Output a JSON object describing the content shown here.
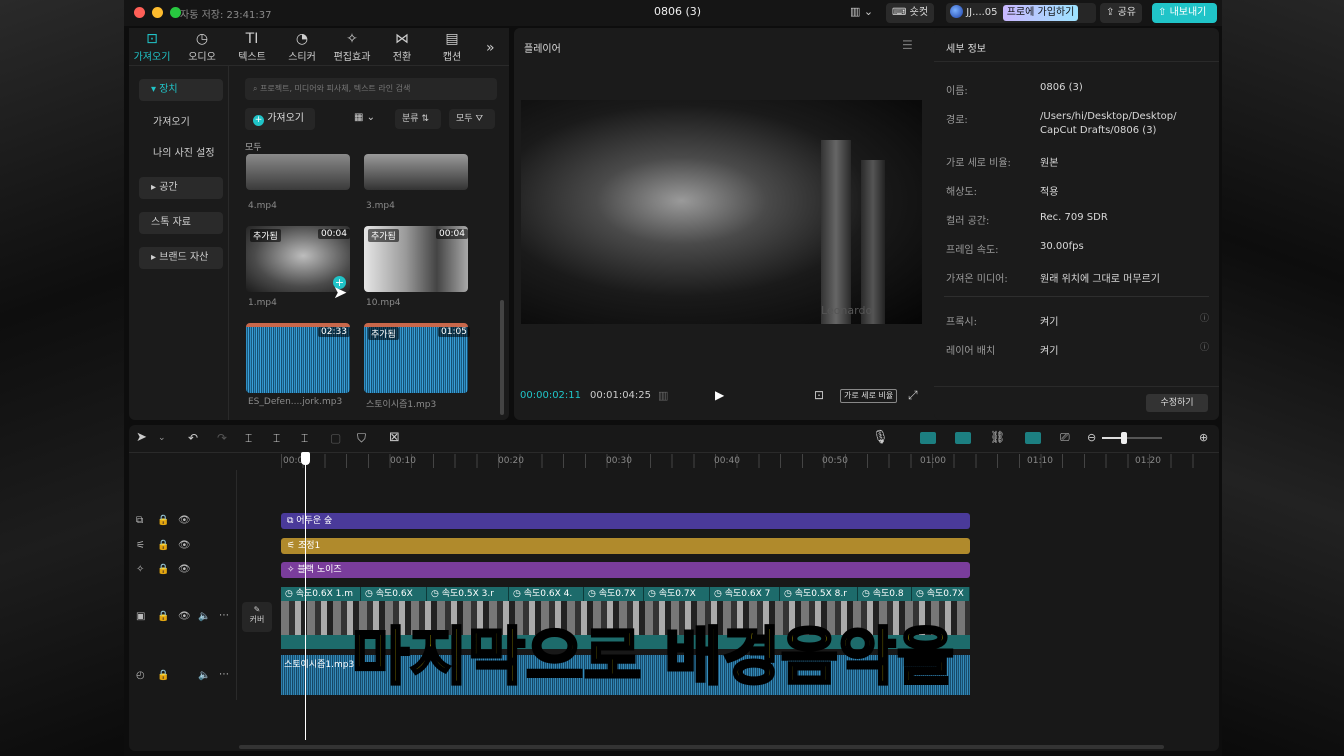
{
  "titlebar": {
    "autosave": "자동 저장: 23:41:37",
    "project": "0806 (3)",
    "shortcut": "숏컷",
    "user": "JJ....05",
    "pro": "프로에 가입하기",
    "share": "공유",
    "export": "내보내기"
  },
  "toolbar": {
    "tabs": [
      "가져오기",
      "오디오",
      "텍스트",
      "스티커",
      "편집효과",
      "전환",
      "캡션"
    ]
  },
  "media_nav": {
    "device": "장치",
    "import": "가져오기",
    "my_presets": "나의 사진 설정",
    "space": "공간",
    "stock": "스톡 자료",
    "brand": "브랜드 자산"
  },
  "media": {
    "search_placeholder": "프로젝트, 미디어와 피사체, 텍스트 라인 검색",
    "import_btn": "가져오기",
    "sort": "분류",
    "all_filter": "모두",
    "all_label": "모두",
    "items": [
      {
        "name": "4.mp4",
        "badge": "",
        "dur": ""
      },
      {
        "name": "3.mp4",
        "badge": "",
        "dur": ""
      },
      {
        "name": "1.mp4",
        "badge": "추가됨",
        "dur": "00:04"
      },
      {
        "name": "10.mp4",
        "badge": "추가됨",
        "dur": "00:04"
      },
      {
        "name": "ES_Defen....jork.mp3",
        "badge": "",
        "dur": "02:33"
      },
      {
        "name": "스토이시즘1.mp3",
        "badge": "추가됨",
        "dur": "01:05"
      }
    ]
  },
  "player": {
    "title": "플레이어",
    "current": "00:00:02:11",
    "total": "00:01:04:25",
    "ratio": "가로 세로 비율",
    "watermark": "Leonardo"
  },
  "details": {
    "title": "세부 정보",
    "rows": [
      {
        "label": "이름:",
        "value": "0806 (3)"
      },
      {
        "label": "경로:",
        "value": "/Users/hi/Desktop/Desktop/"
      },
      {
        "label": "",
        "value": "CapCut Drafts/0806 (3)"
      },
      {
        "label": "가로 세로 비율:",
        "value": "원본"
      },
      {
        "label": "해상도:",
        "value": "적용"
      },
      {
        "label": "컬러 공간:",
        "value": "Rec. 709 SDR"
      },
      {
        "label": "프레임 속도:",
        "value": "30.00fps"
      },
      {
        "label": "가져온 미디어:",
        "value": "원래 위치에 그대로 머무르기"
      }
    ],
    "proxy_label": "프록시:",
    "proxy_value": "켜기",
    "layer_label": "레이어 배치",
    "layer_value": "켜기",
    "edit": "수정하기"
  },
  "timeline": {
    "ticks": [
      "00:00",
      "00:10",
      "00:20",
      "00:30",
      "00:40",
      "00:50",
      "01:00",
      "01:10",
      "01:20"
    ],
    "tracks": {
      "filter": "어두운 숲",
      "adjust": "조정1",
      "effect": "블랙 노이즈",
      "audio": "스토이시즘1.mp3"
    },
    "cover": "커버",
    "clips": [
      "속도0.6X  1.m",
      "속도0.6X",
      "속도0.5X  3.r",
      "속도0.6X  4.",
      "속도0.7X",
      "속도0.7X",
      "속도0.6X  7",
      "속도0.5X  8.r",
      "속도0.8",
      "속도0.7X"
    ],
    "colors": {
      "filter": "#4a3a9a",
      "adjust": "#b08a2c",
      "effect": "#7a3d9c",
      "video": "#1d6b6b",
      "playhead": "#ffffff"
    }
  },
  "subtitle": "마지막으로 배경음악을"
}
